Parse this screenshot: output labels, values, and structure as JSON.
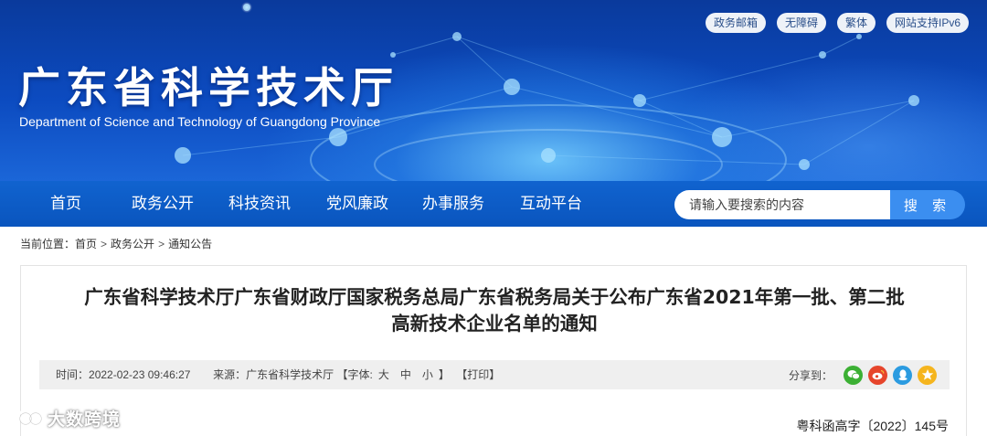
{
  "header": {
    "top_links": [
      "政务邮箱",
      "无障碍",
      "繁体",
      "网站支持IPv6"
    ],
    "site_title": "广东省科学技术厅",
    "site_subtitle": "Department of Science and Technology of Guangdong Province"
  },
  "nav": {
    "items": [
      "首页",
      "政务公开",
      "科技资讯",
      "党风廉政",
      "办事服务",
      "互动平台"
    ],
    "search_placeholder": "请输入要搜索的内容",
    "search_button": "搜 索"
  },
  "breadcrumb": {
    "prefix": "当前位置：",
    "items": [
      "首页",
      "政务公开",
      "通知公告"
    ],
    "separator": ">"
  },
  "article": {
    "title_line1": "广东省科学技术厅广东省财政厅国家税务总局广东省税务局关于公布广东省2021年第一批、第二批",
    "title_line2": "高新技术企业名单的通知",
    "meta": {
      "time_label": "时间：",
      "time": "2022-02-23 09:46:27",
      "source_label": "来源：",
      "source": "广东省科学技术厅",
      "font_label": "【字体:",
      "font_sizes": [
        "大",
        "中",
        "小"
      ],
      "font_close": "】",
      "print": "【打印】",
      "share_label": "分享到：",
      "share_icons": [
        "wechat-icon",
        "weibo-icon",
        "qq-icon",
        "qzone-icon"
      ]
    },
    "doc_number": "粤科函高字〔2022〕145号"
  },
  "watermark": {
    "text": "大数跨境"
  },
  "colors": {
    "banner": "#0c4bc0",
    "nav": "#0a55be",
    "search_button": "#3b8ef0",
    "wechat": "#3cb034",
    "weibo": "#e6452b",
    "qq": "#2b9be0",
    "qzone": "#f5b51e"
  }
}
